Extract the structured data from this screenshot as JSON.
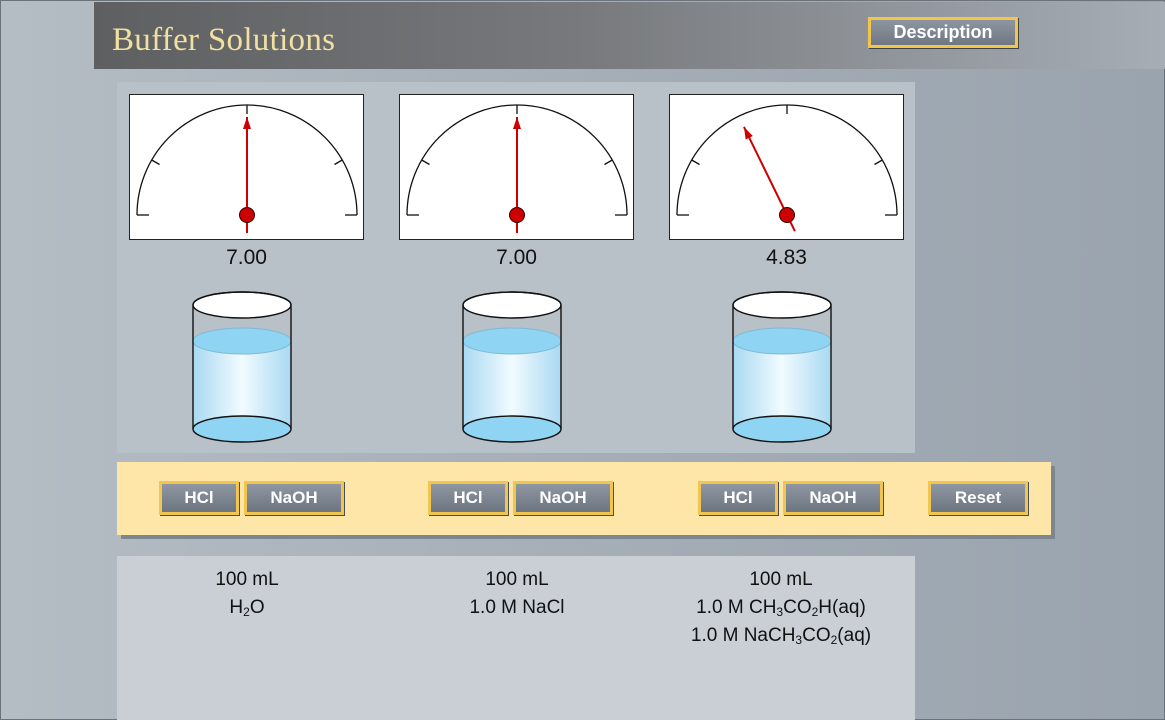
{
  "app": {
    "title": "Buffer Solutions",
    "description_label": "Description"
  },
  "colors": {
    "title_text": "#f1e0a2",
    "button_border": "#f2c64a",
    "button_bar": "#fde6a7",
    "needle": "#cc0000",
    "water": "#bfe8fb"
  },
  "meters": [
    {
      "ph": 7.0,
      "ph_label": "7.00"
    },
    {
      "ph": 7.0,
      "ph_label": "7.00"
    },
    {
      "ph": 4.83,
      "ph_label": "4.83"
    }
  ],
  "controls": {
    "hcl_label": "HCl",
    "naoh_label": "NaOH",
    "reset_label": "Reset"
  },
  "solutions": [
    {
      "volume": "100 mL",
      "line1": {
        "a": "H",
        "sub": "2",
        "b": "O"
      }
    },
    {
      "volume": "100 mL",
      "line1": {
        "a": "1.0 M NaCl",
        "sub": "",
        "b": ""
      }
    },
    {
      "volume": "100 mL",
      "line1": {
        "a": "1.0 M CH",
        "sub": "3",
        "b": "CO",
        "sub2": "2",
        "c": "H(aq)"
      },
      "line2": {
        "a": "1.0 M NaCH",
        "sub": "3",
        "b": "CO",
        "sub2": "2",
        "c": "(aq)"
      }
    }
  ]
}
